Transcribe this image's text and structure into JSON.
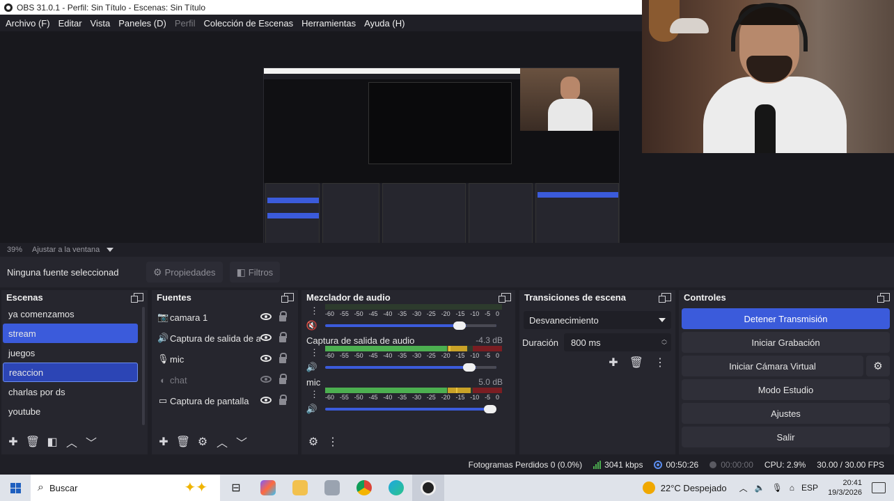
{
  "window": {
    "title": "OBS 31.0.1 - Perfil: Sin Título - Escenas: Sin Título"
  },
  "menu": [
    {
      "label": "Archivo (F)",
      "enabled": true
    },
    {
      "label": "Editar",
      "enabled": true
    },
    {
      "label": "Vista",
      "enabled": true
    },
    {
      "label": "Paneles (D)",
      "enabled": true
    },
    {
      "label": "Perfil",
      "enabled": false
    },
    {
      "label": "Colección de Escenas",
      "enabled": true
    },
    {
      "label": "Herramientas",
      "enabled": true
    },
    {
      "label": "Ayuda (H)",
      "enabled": true
    }
  ],
  "preview": {
    "zoom": "39%",
    "fit_label": "Ajustar a la ventana"
  },
  "source_toolbar": {
    "status": "Ninguna fuente seleccionad",
    "properties_label": "Propiedades",
    "filters_label": "Filtros"
  },
  "scenes": {
    "title": "Escenas",
    "items": [
      "ya comenzamos",
      "stream",
      "juegos",
      "reaccion",
      "charlas por ds",
      "youtube"
    ],
    "selected_index": 1,
    "editing_index": 3
  },
  "sources": {
    "title": "Fuentes",
    "items": [
      {
        "label": "camara 1",
        "icon": "camera-icon",
        "visible": true
      },
      {
        "label": "Captura de salida de au",
        "icon": "speaker-icon",
        "visible": true
      },
      {
        "label": "mic",
        "icon": "microphone-icon",
        "visible": true
      },
      {
        "label": "chat",
        "icon": "browser-icon",
        "visible": false
      },
      {
        "label": "Captura de pantalla",
        "icon": "monitor-icon",
        "visible": true
      }
    ]
  },
  "mixer": {
    "title": "Mezclador de audio",
    "scale": [
      "-60",
      "-55",
      "-50",
      "-45",
      "-40",
      "-35",
      "-30",
      "-25",
      "-20",
      "-15",
      "-10",
      "-5",
      "0"
    ],
    "channels": [
      {
        "name": "",
        "db": "",
        "level": 0.0,
        "peak": 0.0,
        "volume": 0.82,
        "muted": true
      },
      {
        "name": "Captura de salida de audio",
        "db": "-4.3 dB",
        "level": 0.8,
        "peak": 0.7,
        "volume": 0.88,
        "muted": false
      },
      {
        "name": "mic",
        "db": "5.0 dB",
        "level": 0.82,
        "peak": 0.74,
        "volume": 1.0,
        "muted": false
      }
    ]
  },
  "transitions": {
    "title": "Transiciones de escena",
    "selected": "Desvanecimiento",
    "duration_label": "Duración",
    "duration_value": "800 ms"
  },
  "controls": {
    "title": "Controles",
    "stop_stream": "Detener Transmisión",
    "start_record": "Iniciar Grabación",
    "start_virtual_cam": "Iniciar Cámara Virtual",
    "studio_mode": "Modo Estudio",
    "settings": "Ajustes",
    "exit": "Salir"
  },
  "status": {
    "dropped_frames": "Fotogramas Perdidos 0 (0.0%)",
    "bitrate": "3041 kbps",
    "stream_time": "00:50:26",
    "record_time": "00:00:00",
    "cpu": "CPU: 2.9%",
    "fps": "30.00 / 30.00 FPS"
  },
  "taskbar": {
    "search_placeholder": "Buscar",
    "weather": "22°C  Despejado",
    "language": "ESP",
    "time": "20:41",
    "date": "19/3/2026"
  }
}
